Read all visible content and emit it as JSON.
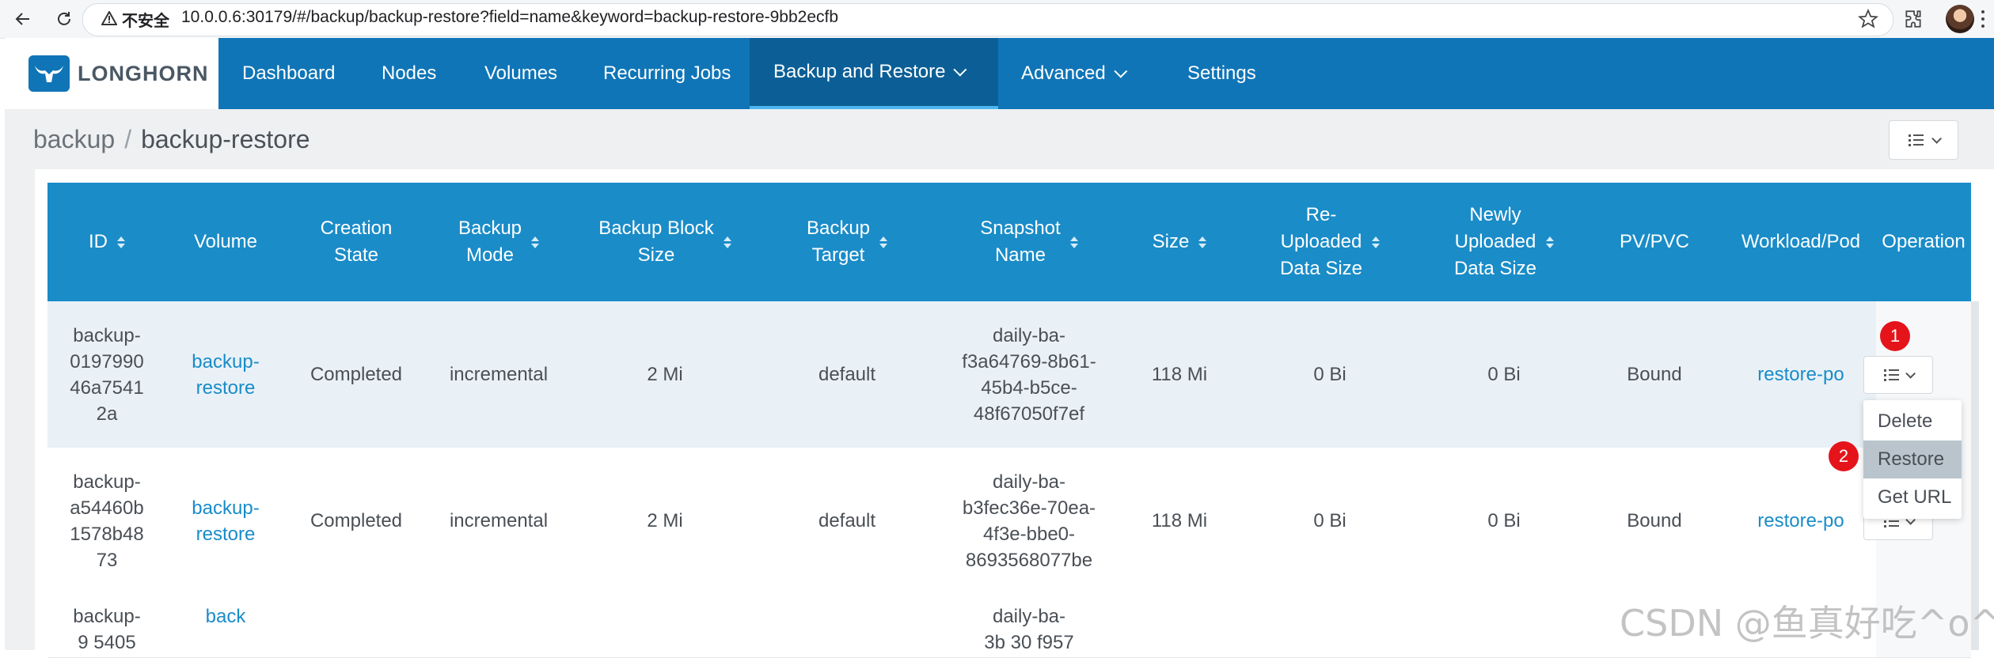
{
  "browser": {
    "security_label": "不安全",
    "url": "10.0.0.6:30179/#/backup/backup-restore?field=name&keyword=backup-restore-9bb2ecfb"
  },
  "brand": {
    "name": "LONGHORN",
    "header_color": "#0f75b7",
    "active_tab_color": "#0c5f96"
  },
  "nav": {
    "items": [
      "Dashboard",
      "Nodes",
      "Volumes",
      "Recurring Jobs",
      "Backup and Restore",
      "Advanced",
      "Settings"
    ],
    "active": "Backup and Restore"
  },
  "breadcrumb": {
    "parent": "backup",
    "separator": "/",
    "current": "backup-restore"
  },
  "table": {
    "columns": [
      "ID",
      "Volume",
      "Creation\nState",
      "Backup\nMode",
      "Backup Block\nSize",
      "Backup\nTarget",
      "Snapshot\nName",
      "Size",
      "Re-\nUploaded\nData Size",
      "Newly\nUploaded\nData Size",
      "PV/PVC",
      "Workload/Pod",
      "Operation"
    ],
    "rows": [
      {
        "id": "backup-\n0197990\n46a7541\n2a",
        "volume": "backup-\nrestore",
        "creation_state": "Completed",
        "backup_mode": "incremental",
        "block_size": "2 Mi",
        "target": "default",
        "snapshot": "daily-ba-\nf3a64769-8b61-\n45b4-b5ce-\n48f67050f7ef",
        "size": "118 Mi",
        "reuploaded": "0 Bi",
        "newly_uploaded": "0 Bi",
        "pv_pvc": "Bound",
        "workload": "restore-po"
      },
      {
        "id": "backup-\na54460b\n1578b48\n73",
        "volume": "backup-\nrestore",
        "creation_state": "Completed",
        "backup_mode": "incremental",
        "block_size": "2 Mi",
        "target": "default",
        "snapshot": "daily-ba-\nb3fec36e-70ea-\n4f3e-bbe0-\n8693568077be",
        "size": "118 Mi",
        "reuploaded": "0 Bi",
        "newly_uploaded": "0 Bi",
        "pv_pvc": "Bound",
        "workload": "restore-po"
      },
      {
        "id": "backup-\n9   5405",
        "volume": "back",
        "snapshot": "daily-ba-\n3b   30   f957"
      }
    ]
  },
  "operation_menu": {
    "items": [
      "Delete",
      "Restore",
      "Get URL"
    ],
    "highlighted": "Restore"
  },
  "annotations": {
    "badge_1": "1",
    "badge_2": "2"
  },
  "watermark": "CSDN @鱼真好吃^o^"
}
